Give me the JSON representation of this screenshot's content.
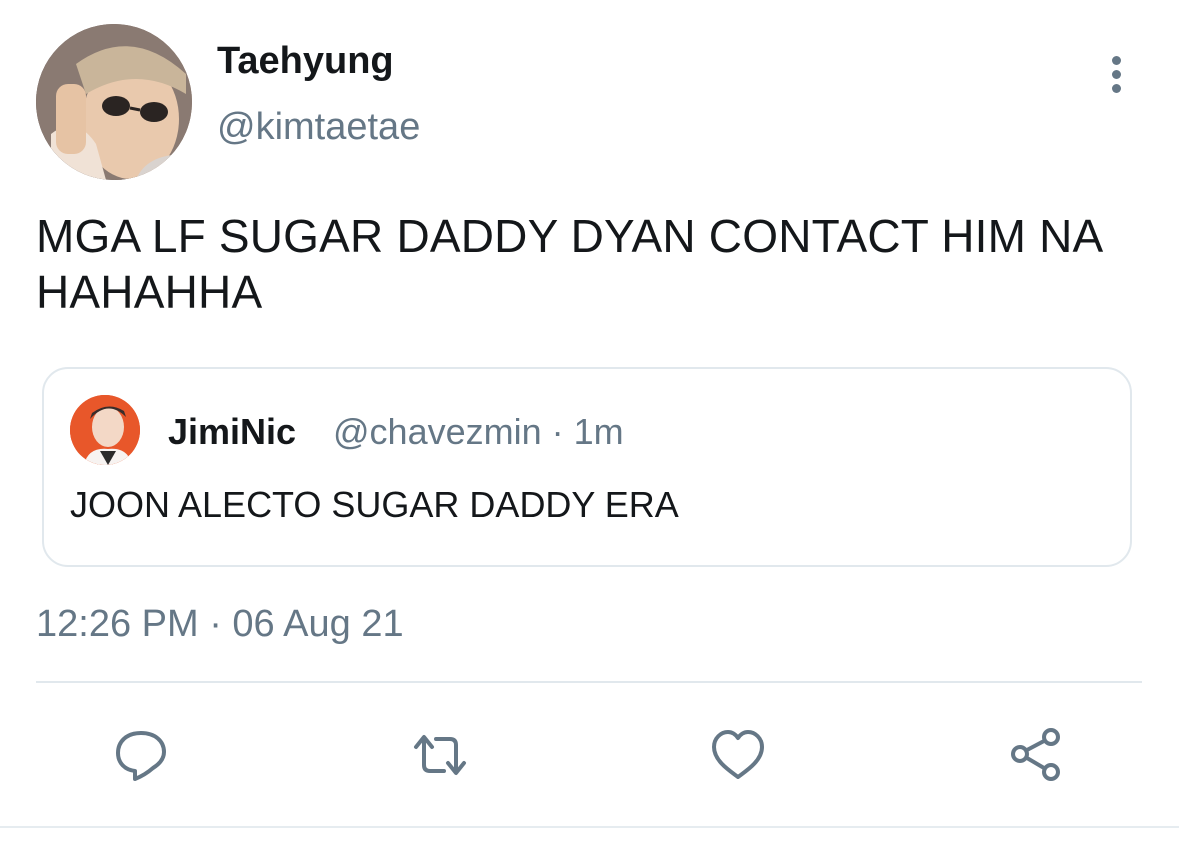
{
  "author": {
    "name": "Taehyung",
    "handle": "@kimtaetae"
  },
  "tweet": {
    "text": "MGA LF SUGAR DADDY DYAN CONTACT HIM NA HAHAHHA",
    "timestamp": "12:26 PM · 06 Aug 21"
  },
  "quoted_tweet": {
    "name": "JimiNic",
    "handle": "@chavezmin",
    "time": "1m",
    "separator": "·",
    "text": "JOON ALECTO SUGAR DADDY ERA"
  },
  "actions": [
    "reply-icon",
    "retweet-icon",
    "like-icon",
    "share-icon"
  ],
  "colors": {
    "text": "#14171a",
    "secondary": "#657786",
    "border": "#e1e8ed"
  }
}
